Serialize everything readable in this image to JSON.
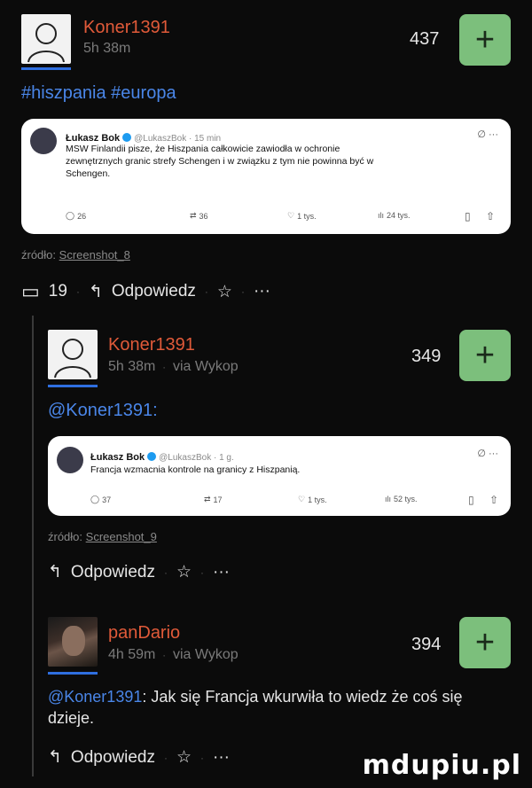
{
  "post": {
    "username": "Koner1391",
    "time": "5h 38m",
    "votes": "437",
    "tags": "#hiszpania #europa",
    "tweet": {
      "name": "Łukasz Bok",
      "handle": "@LukaszBok · 15 min",
      "text": "MSW Finlandii pisze, że Hiszpania całkowicie zawiodła w ochronie zewnętrznych granic strefy Schengen i w związku z tym nie powinna być w Schengen.",
      "replies": "26",
      "retweets": "36",
      "likes": "1 tys.",
      "views": "24 tys."
    },
    "source_label": "źródło:",
    "source_link": "Screenshot_8",
    "comment_count": "19",
    "reply_label": "Odpowiedz"
  },
  "comments": [
    {
      "username": "Koner1391",
      "time": "5h 38m",
      "via": "via Wykop",
      "votes": "349",
      "mention": "@Koner1391:",
      "tweet": {
        "name": "Łukasz Bok",
        "handle": "@LukaszBok · 1 g.",
        "text": "Francja wzmacnia kontrole na granicy z Hiszpanią.",
        "replies": "37",
        "retweets": "17",
        "likes": "1 tys.",
        "views": "52 tys."
      },
      "source_label": "źródło:",
      "source_link": "Screenshot_9",
      "reply_label": "Odpowiedz"
    },
    {
      "username": "panDario",
      "time": "4h 59m",
      "via": "via Wykop",
      "votes": "394",
      "mention": "@Koner1391",
      "text": ": Jak się Francja wkurwiła to wiedz że coś się dzieje.",
      "reply_label": "Odpowiedz"
    }
  ],
  "watermark": "mdupiu.pl",
  "colors": {
    "username": "#e05a39",
    "link": "#4a86e8",
    "plus_button": "#7cbf7c",
    "background": "#0b0b0b"
  }
}
